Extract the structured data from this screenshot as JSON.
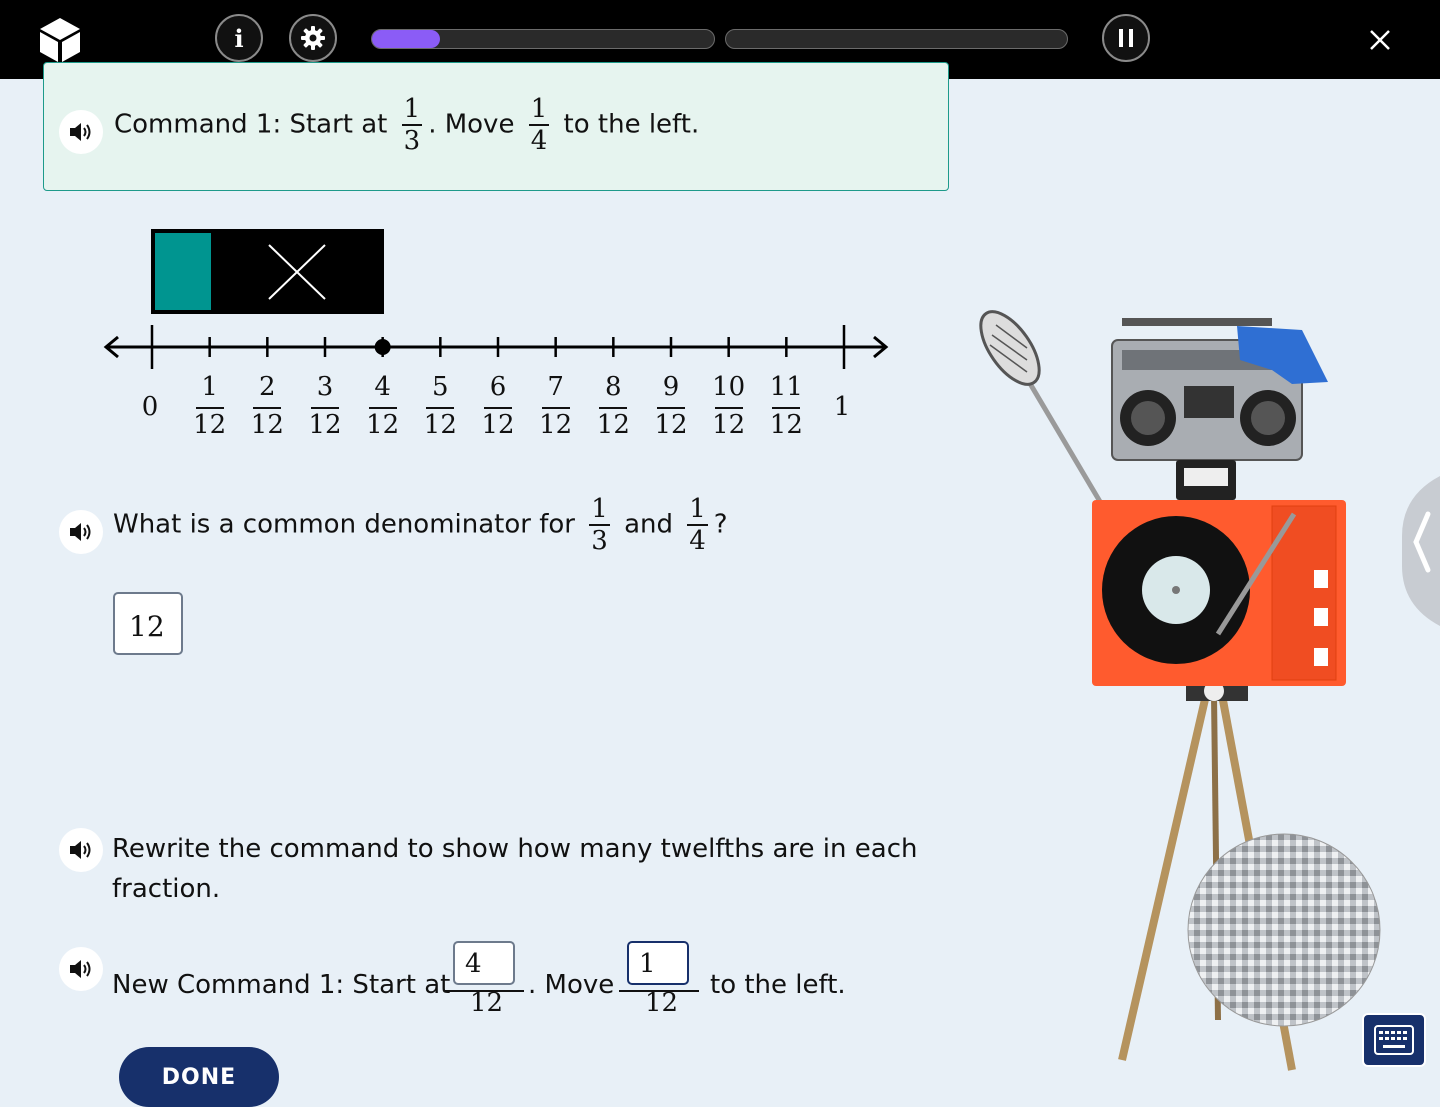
{
  "topbar": {
    "progress": [
      0.2,
      0
    ],
    "accent": "#8b5cf6",
    "icons": [
      "cube-logo-icon",
      "info-icon",
      "gear-icon",
      "pause-icon",
      "close-icon"
    ],
    "info_glyph": "i"
  },
  "command1": {
    "prefix": "Command 1: Start at",
    "start": {
      "num": "1",
      "den": "3"
    },
    "middle": ". Move",
    "move": {
      "num": "1",
      "den": "4"
    },
    "suffix": "to the left."
  },
  "number_line": {
    "start_label": "0",
    "end_label": "1",
    "fractions": [
      {
        "num": "1",
        "den": "12"
      },
      {
        "num": "2",
        "den": "12"
      },
      {
        "num": "3",
        "den": "12"
      },
      {
        "num": "4",
        "den": "12"
      },
      {
        "num": "5",
        "den": "12"
      },
      {
        "num": "6",
        "den": "12"
      },
      {
        "num": "7",
        "den": "12"
      },
      {
        "num": "8",
        "den": "12"
      },
      {
        "num": "9",
        "den": "12"
      },
      {
        "num": "10",
        "den": "12"
      },
      {
        "num": "11",
        "den": "12"
      }
    ],
    "marked_point_twelfths": 4
  },
  "question1": {
    "prefix": "What is a common denominator for",
    "a": {
      "num": "1",
      "den": "3"
    },
    "and": "and",
    "b": {
      "num": "1",
      "den": "4"
    },
    "suffix": "?",
    "answer": "12"
  },
  "question2": {
    "line1": "Rewrite the command to show how many twelfths are in each",
    "line2": "fraction."
  },
  "new_command": {
    "prefix": "New Command 1: Start at",
    "start_num_value": "4",
    "start_den": "12",
    "middle": ". Move",
    "move_num_value": "1",
    "move_den": "12",
    "suffix": "to the left."
  },
  "done_label": "DONE",
  "colors": {
    "teal": "#009590",
    "navy": "#17306b",
    "box_border": "#1d9a8a"
  }
}
